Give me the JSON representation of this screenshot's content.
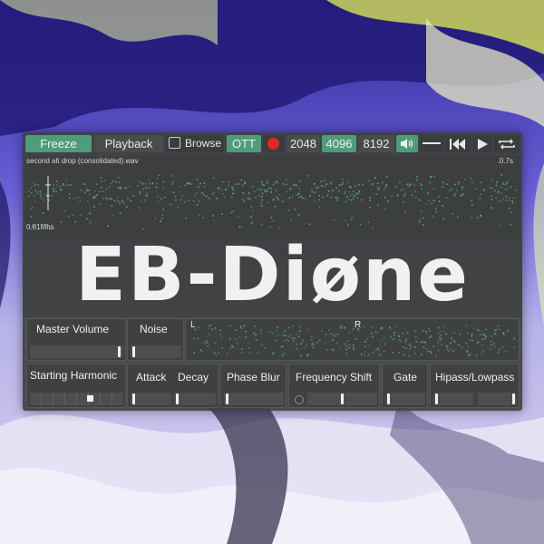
{
  "toolbar": {
    "freeze_label": "Freeze",
    "playback_label": "Playback",
    "browse_label": "Browse",
    "ott_label": "OTT",
    "fft_sizes": [
      "2048",
      "4096",
      "8192"
    ],
    "selected_fft": "4096"
  },
  "waveform": {
    "filename": "second alt drop (consolidated).wav",
    "duration": ".0.7s",
    "y_label": "0.81Mhs"
  },
  "plugin_title": "EB-Diøne",
  "controls": {
    "master_volume": {
      "label": "Master Volume",
      "value": 0.97
    },
    "noise": {
      "label": "Noise",
      "value": 0.04
    },
    "stereo": {
      "left_label": "L",
      "right_label": "R"
    },
    "starting_harmonic": {
      "label": "Starting Harmonic",
      "value": 0.63
    },
    "attack": {
      "label": "Attack",
      "value": 0.04
    },
    "decay": {
      "label": "Decay",
      "value": 0.04
    },
    "phase_blur": {
      "label": "Phase Blur",
      "value": 0.04
    },
    "frequency_shift": {
      "label": "Frequency Shift",
      "value": 0.5
    },
    "gate": {
      "label": "Gate",
      "value": 0.04
    },
    "hipass": {
      "label": "Hipass/Lowpass",
      "value_low": 0.04,
      "value_high": 0.96
    }
  },
  "colors": {
    "accent": "#4e9c78",
    "panel": "#3f4140",
    "record": "#e0282a",
    "spectrum": "#55c98a"
  },
  "icons": [
    "record-dot-icon",
    "speaker-icon",
    "line-icon",
    "skip-back-icon",
    "play-icon",
    "loop-icon"
  ]
}
